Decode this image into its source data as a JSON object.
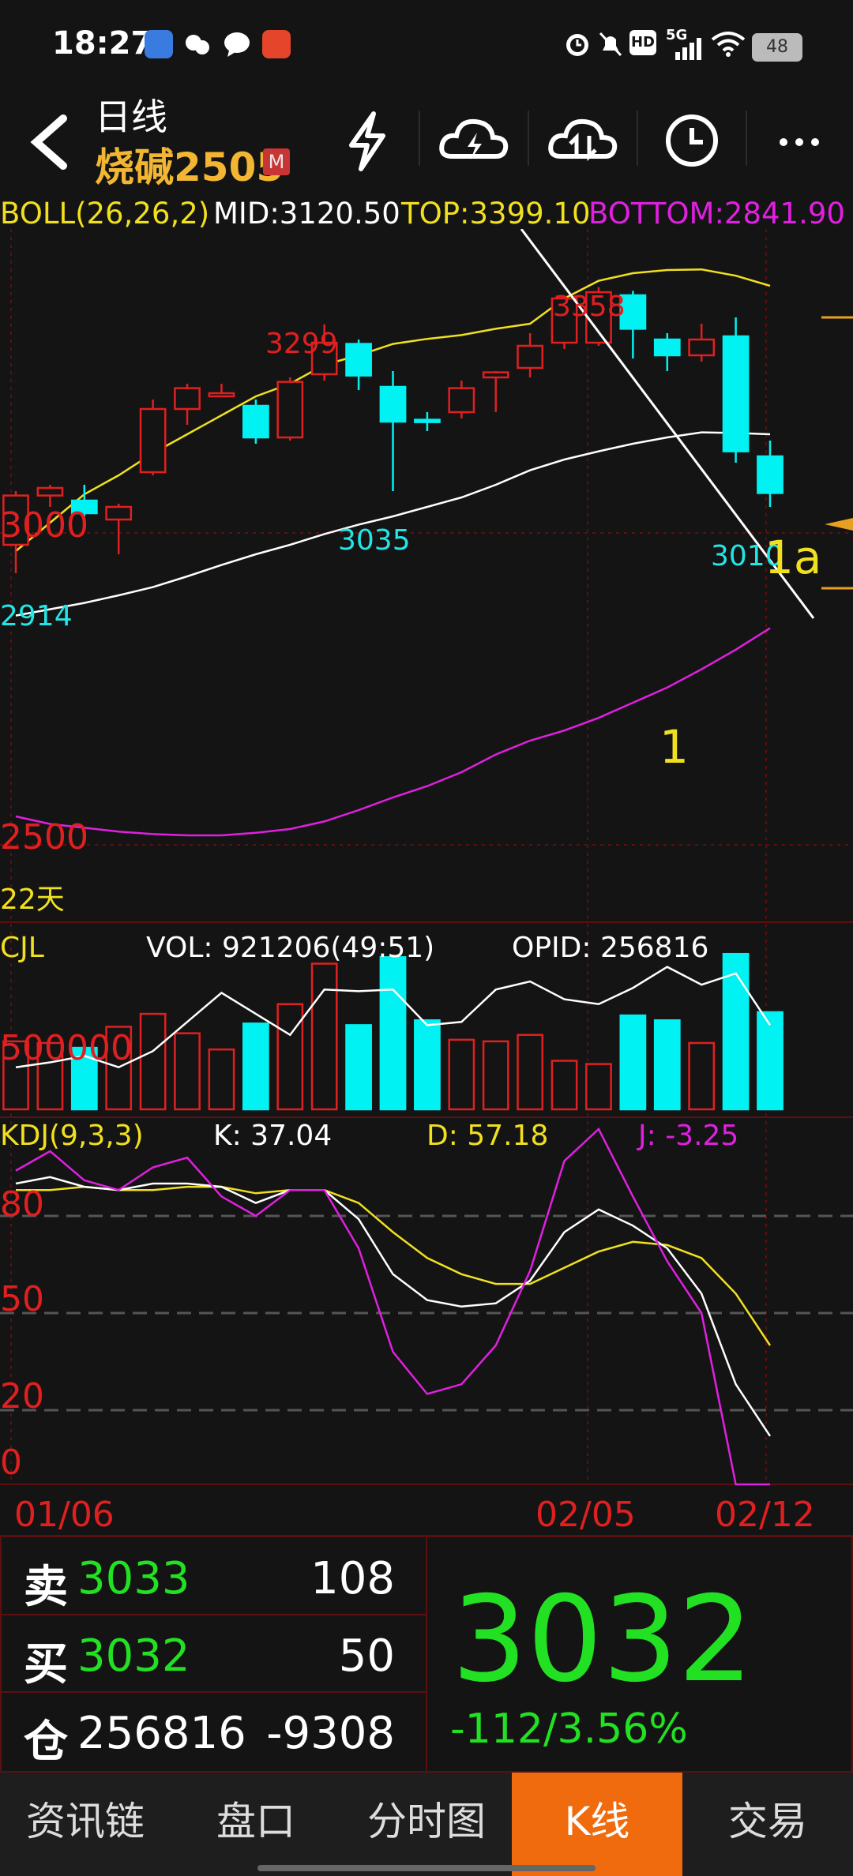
{
  "status": {
    "time": "18:27",
    "network": "5G",
    "battery": "48"
  },
  "header": {
    "period": "日线",
    "symbol": "烧碱2505",
    "badge": "M",
    "icons": [
      "lightning-icon",
      "cloud-lightning-icon",
      "cloud-sync-icon",
      "clock-icon",
      "more-icon"
    ]
  },
  "boll": {
    "name": "BOLL(26,26,2)",
    "mid": "MID:3120.50",
    "top": "TOP:3399.10",
    "bottom": "BOTTOM:2841.90"
  },
  "main_chart": {
    "y_labels": [
      "3000",
      "2500"
    ],
    "days_label": "22天",
    "annotations": {
      "high1": "3299",
      "high2": "3358",
      "low1": "3035",
      "low2": "3010",
      "low3": "2914",
      "mark_1a": "1a",
      "mark_1": "1"
    }
  },
  "volume": {
    "name": "CJL",
    "vol": "VOL: 921206(49:51)",
    "opid": "OPID: 256816",
    "y_label": "500000"
  },
  "kdj": {
    "name": "KDJ(9,3,3)",
    "k": "K: 37.04",
    "d": "D: 57.18",
    "j": "J: -3.25",
    "levels": [
      "80",
      "50",
      "20",
      "0"
    ]
  },
  "dates": [
    "01/06",
    "02/05",
    "02/12"
  ],
  "colors": {
    "up": "#e02020",
    "down": "#00f2f2",
    "yellow": "#f0e020",
    "magenta": "#e020e0",
    "green": "#22e122",
    "orange": "#f06a0e"
  },
  "chart_data": {
    "type": "candlestick",
    "ylim": [
      2450,
      3450
    ],
    "candles": [
      {
        "o": 2950,
        "h": 3035,
        "l": 2905,
        "c": 3028
      },
      {
        "o": 3028,
        "h": 3045,
        "l": 3010,
        "c": 3040
      },
      {
        "o": 3020,
        "h": 3045,
        "l": 2995,
        "c": 3000
      },
      {
        "o": 2990,
        "h": 3015,
        "l": 2935,
        "c": 3010
      },
      {
        "o": 3065,
        "h": 3180,
        "l": 3060,
        "c": 3165
      },
      {
        "o": 3165,
        "h": 3205,
        "l": 3140,
        "c": 3198
      },
      {
        "o": 3185,
        "h": 3205,
        "l": 3185,
        "c": 3190
      },
      {
        "o": 3170,
        "h": 3180,
        "l": 3110,
        "c": 3120
      },
      {
        "o": 3120,
        "h": 3215,
        "l": 3115,
        "c": 3208
      },
      {
        "o": 3220,
        "h": 3299,
        "l": 3210,
        "c": 3270
      },
      {
        "o": 3268,
        "h": 3275,
        "l": 3195,
        "c": 3218
      },
      {
        "o": 3200,
        "h": 3225,
        "l": 3035,
        "c": 3145
      },
      {
        "o": 3148,
        "h": 3160,
        "l": 3130,
        "c": 3146
      },
      {
        "o": 3160,
        "h": 3210,
        "l": 3150,
        "c": 3198
      },
      {
        "o": 3215,
        "h": 3225,
        "l": 3160,
        "c": 3223
      },
      {
        "o": 3230,
        "h": 3285,
        "l": 3215,
        "c": 3265
      },
      {
        "o": 3270,
        "h": 3345,
        "l": 3260,
        "c": 3340
      },
      {
        "o": 3270,
        "h": 3358,
        "l": 3265,
        "c": 3350
      },
      {
        "o": 3345,
        "h": 3352,
        "l": 3245,
        "c": 3292
      },
      {
        "o": 3275,
        "h": 3285,
        "l": 3225,
        "c": 3250
      },
      {
        "o": 3250,
        "h": 3300,
        "l": 3240,
        "c": 3275
      },
      {
        "o": 3280,
        "h": 3310,
        "l": 3080,
        "c": 3098
      },
      {
        "o": 3090,
        "h": 3115,
        "l": 3010,
        "c": 3032
      }
    ],
    "boll_top": [
      2940,
      2985,
      3030,
      3060,
      3095,
      3125,
      3155,
      3185,
      3205,
      3235,
      3250,
      3268,
      3276,
      3282,
      3292,
      3300,
      3340,
      3368,
      3380,
      3385,
      3386,
      3376,
      3360
    ],
    "boll_mid": [
      2838,
      2848,
      2858,
      2870,
      2883,
      2900,
      2918,
      2935,
      2950,
      2967,
      2982,
      2995,
      3010,
      3025,
      3045,
      3068,
      3085,
      3098,
      3110,
      3120,
      3128,
      3127,
      3125
    ],
    "boll_bottom": [
      2520,
      2508,
      2502,
      2496,
      2492,
      2490,
      2490,
      2494,
      2500,
      2512,
      2530,
      2550,
      2568,
      2590,
      2618,
      2640,
      2656,
      2676,
      2700,
      2724,
      2753,
      2784,
      2818
    ],
    "volume": [
      0.42,
      0.41,
      0.38,
      0.51,
      0.59,
      0.47,
      0.37,
      0.53,
      0.65,
      0.9,
      0.52,
      0.94,
      0.55,
      0.43,
      0.42,
      0.46,
      0.3,
      0.28,
      0.58,
      0.55,
      0.41,
      0.96,
      0.6
    ],
    "opid": [
      0.26,
      0.29,
      0.33,
      0.26,
      0.36,
      0.54,
      0.72,
      0.59,
      0.46,
      0.74,
      0.73,
      0.74,
      0.52,
      0.54,
      0.74,
      0.79,
      0.68,
      0.65,
      0.75,
      0.88,
      0.77,
      0.84,
      0.52
    ],
    "vol_dir": [
      "up",
      "up",
      "down",
      "up",
      "up",
      "up",
      "up",
      "down",
      "up",
      "up",
      "down",
      "down",
      "down",
      "up",
      "up",
      "up",
      "up",
      "up",
      "down",
      "down",
      "up",
      "down",
      "down"
    ],
    "kdj_k": [
      90,
      92,
      89,
      88,
      90,
      90,
      89,
      84,
      88,
      88,
      79,
      62,
      54,
      52,
      53,
      60,
      75,
      82,
      77,
      70,
      56,
      28,
      12
    ],
    "kdj_d": [
      88,
      88,
      89,
      88,
      88,
      89,
      89,
      87,
      88,
      88,
      84,
      75,
      67,
      62,
      59,
      59,
      64,
      69,
      72,
      71,
      67,
      56,
      40
    ],
    "kdj_j": [
      94,
      100,
      91,
      88,
      95,
      98,
      86,
      80,
      88,
      88,
      70,
      38,
      25,
      28,
      40,
      63,
      97,
      108,
      86,
      66,
      50,
      -3.25,
      -30
    ]
  }
}
